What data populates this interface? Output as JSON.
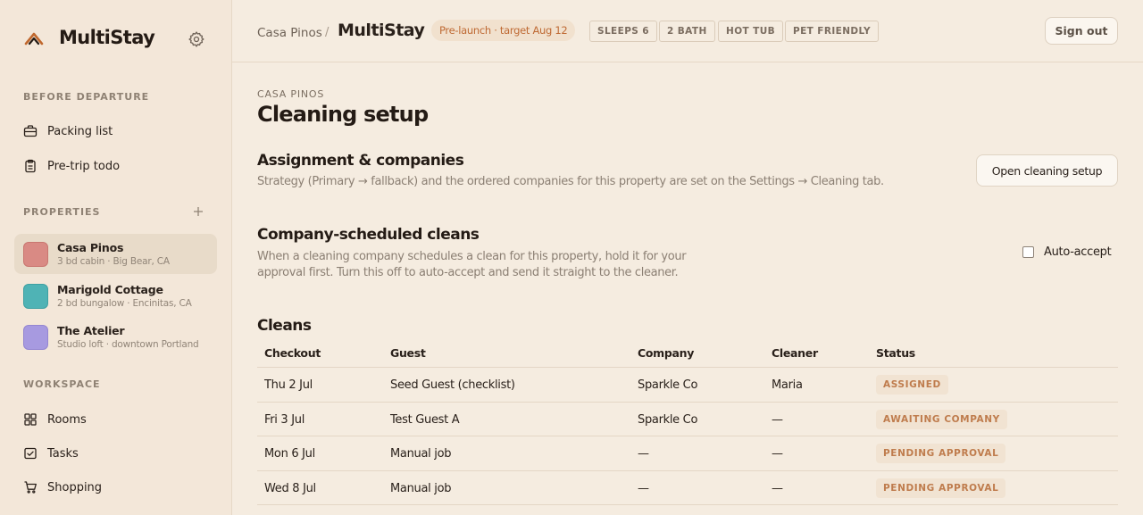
{
  "app": {
    "name": "MultiStay",
    "accent": "#c0682e"
  },
  "sidebar": {
    "before_departure": {
      "label": "BEFORE DEPARTURE",
      "items": [
        {
          "label": "Packing list",
          "icon": "suitcase-icon"
        },
        {
          "label": "Pre-trip todo",
          "icon": "clipboard-icon"
        }
      ]
    },
    "properties": {
      "label": "PROPERTIES",
      "items": [
        {
          "name": "Casa Pinos",
          "subtitle": "3 bd cabin · Big Bear, CA",
          "color": "#d98a84",
          "active": true
        },
        {
          "name": "Marigold Cottage",
          "subtitle": "2 bd bungalow · Encinitas, CA",
          "color": "#4fb3b5",
          "active": false
        },
        {
          "name": "The Atelier",
          "subtitle": "Studio loft · downtown Portland",
          "color": "#a79ae0",
          "active": false
        }
      ]
    },
    "workspace": {
      "label": "WORKSPACE",
      "items": [
        {
          "label": "Rooms",
          "icon": "grid-icon"
        },
        {
          "label": "Tasks",
          "icon": "checkbox-icon"
        },
        {
          "label": "Shopping",
          "icon": "cart-icon"
        }
      ]
    }
  },
  "header": {
    "breadcrumb_parent": "Casa Pinos",
    "breadcrumb_sep": "/",
    "title": "MultiStay",
    "prelaunch": "Pre-launch · target Aug 12",
    "tags": [
      "SLEEPS 6",
      "2 BATH",
      "HOT TUB",
      "PET FRIENDLY"
    ],
    "sign_out": "Sign out"
  },
  "main": {
    "eyebrow": "CASA PINOS",
    "title": "Cleaning setup",
    "assignment": {
      "heading": "Assignment & companies",
      "description": "Strategy (Primary → fallback) and the ordered companies for this property are set on the Settings → Cleaning tab.",
      "button": "Open cleaning setup"
    },
    "company_cleans": {
      "heading": "Company-scheduled cleans",
      "description_line1": "When a cleaning company schedules a clean for this property, hold it for your",
      "description_line2": "approval first. Turn this off to auto-accept and send it straight to the cleaner.",
      "toggle_label": "Auto-accept",
      "toggle_checked": false
    },
    "cleans": {
      "heading": "Cleans",
      "columns": [
        "Checkout",
        "Guest",
        "Company",
        "Cleaner",
        "Status"
      ],
      "rows": [
        {
          "checkout": "Thu 2 Jul",
          "guest": "Seed Guest (checklist)",
          "company": "Sparkle Co",
          "cleaner": "Maria",
          "status": "ASSIGNED"
        },
        {
          "checkout": "Fri 3 Jul",
          "guest": "Test Guest A",
          "company": "Sparkle Co",
          "cleaner": "—",
          "status": "AWAITING COMPANY"
        },
        {
          "checkout": "Mon 6 Jul",
          "guest": "Manual job",
          "company": "—",
          "cleaner": "—",
          "status": "PENDING APPROVAL"
        },
        {
          "checkout": "Wed 8 Jul",
          "guest": "Manual job",
          "company": "—",
          "cleaner": "—",
          "status": "PENDING APPROVAL"
        }
      ]
    }
  }
}
